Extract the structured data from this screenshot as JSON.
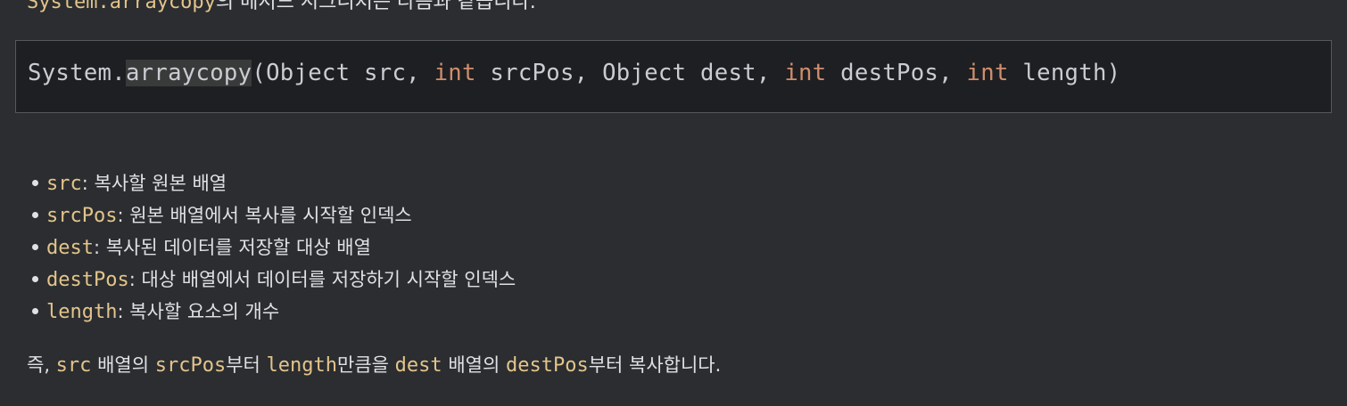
{
  "intro": {
    "code": "System.arraycopy",
    "text": "의 메서드 시그니처는 다음과 같습니다."
  },
  "signature": {
    "prefix": "System.",
    "method": "arraycopy",
    "p1": "(Object src, ",
    "int1": "int",
    "p2": " srcPos, Object dest, ",
    "int2": "int",
    "p3": " destPos, ",
    "int3": "int",
    "p4": " length)"
  },
  "params": [
    {
      "name": "src",
      "desc": ": 복사할 원본 배열"
    },
    {
      "name": "srcPos",
      "desc": ": 원본 배열에서 복사를 시작할 인덱스"
    },
    {
      "name": "dest",
      "desc": ": 복사된 데이터를 저장할 대상 배열"
    },
    {
      "name": "destPos",
      "desc": ": 대상 배열에서 데이터를 저장하기 시작할 인덱스"
    },
    {
      "name": "length",
      "desc": ": 복사할 요소의 개수"
    }
  ],
  "summary": {
    "t0": "즉, ",
    "c1": "src",
    "t1": " 배열의 ",
    "c2": "srcPos",
    "t2": "부터 ",
    "c3": "length",
    "t3": "만큼을 ",
    "c4": "dest",
    "t4": " 배열의 ",
    "c5": "destPos",
    "t5": "부터 복사합니다."
  }
}
